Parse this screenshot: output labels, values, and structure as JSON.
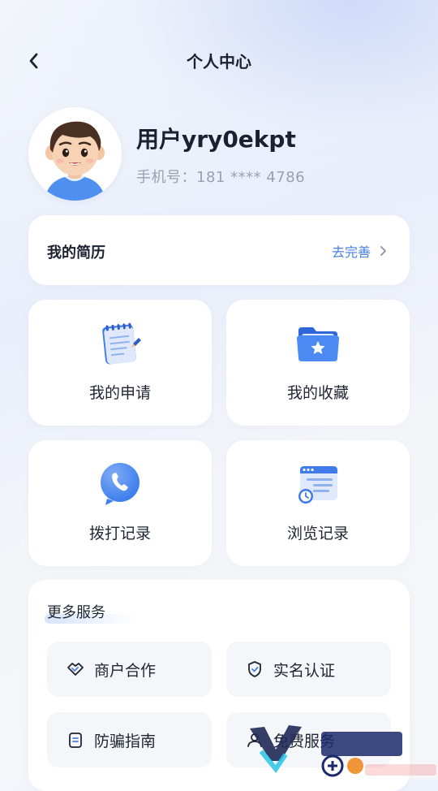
{
  "header": {
    "title": "个人中心",
    "back_icon": "chevron-left-icon"
  },
  "profile": {
    "username": "用户yry0ekpt",
    "phone": "手机号：181 **** 4786"
  },
  "resume": {
    "label": "我的简历",
    "action": "去完善"
  },
  "tiles": [
    {
      "label": "我的申请",
      "icon": "notepad-icon"
    },
    {
      "label": "我的收藏",
      "icon": "star-folder-icon"
    },
    {
      "label": "拨打记录",
      "icon": "phone-icon"
    },
    {
      "label": "浏览记录",
      "icon": "browser-clock-icon"
    }
  ],
  "services": {
    "title": "更多服务",
    "items": [
      {
        "label": "商户合作",
        "icon": "handshake-icon"
      },
      {
        "label": "实名认证",
        "icon": "shield-check-icon"
      },
      {
        "label": "防骗指南",
        "icon": "document-icon"
      },
      {
        "label": "免费服务",
        "icon": "user-icon"
      }
    ]
  },
  "colors": {
    "accent": "#4a7fe0",
    "card": "#ffffff",
    "service_bg": "#f4f6f9"
  }
}
